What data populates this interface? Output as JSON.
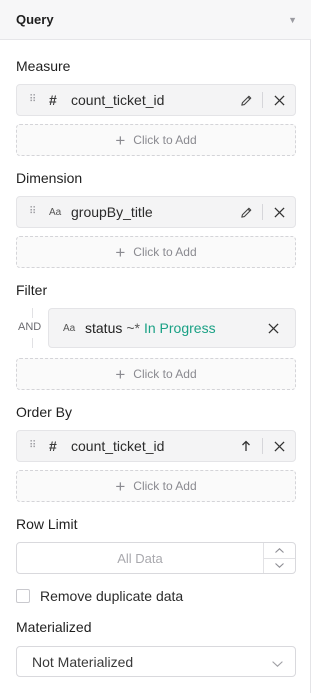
{
  "header": {
    "title": "Query",
    "collapse_icon": "triangle-down-icon"
  },
  "measure": {
    "label": "Measure",
    "items": [
      {
        "type": "#",
        "name": "count_ticket_id"
      }
    ],
    "add_label": "Click to Add"
  },
  "dimension": {
    "label": "Dimension",
    "items": [
      {
        "type": "Aa",
        "name": "groupBy_title"
      }
    ],
    "add_label": "Click to Add"
  },
  "filter": {
    "label": "Filter",
    "conjunction": "AND",
    "items": [
      {
        "type": "Aa",
        "field": "status",
        "operator": "~*",
        "value": "In Progress"
      }
    ],
    "add_label": "Click to Add",
    "value_color": "#1aa185"
  },
  "order_by": {
    "label": "Order By",
    "items": [
      {
        "type": "#",
        "name": "count_ticket_id",
        "direction_icon": "arrow-up-icon"
      }
    ],
    "add_label": "Click to Add"
  },
  "row_limit": {
    "label": "Row Limit",
    "placeholder": "All Data"
  },
  "dedupe": {
    "label": "Remove duplicate data",
    "checked": false
  },
  "materialized": {
    "label": "Materialized",
    "selected": "Not Materialized"
  }
}
